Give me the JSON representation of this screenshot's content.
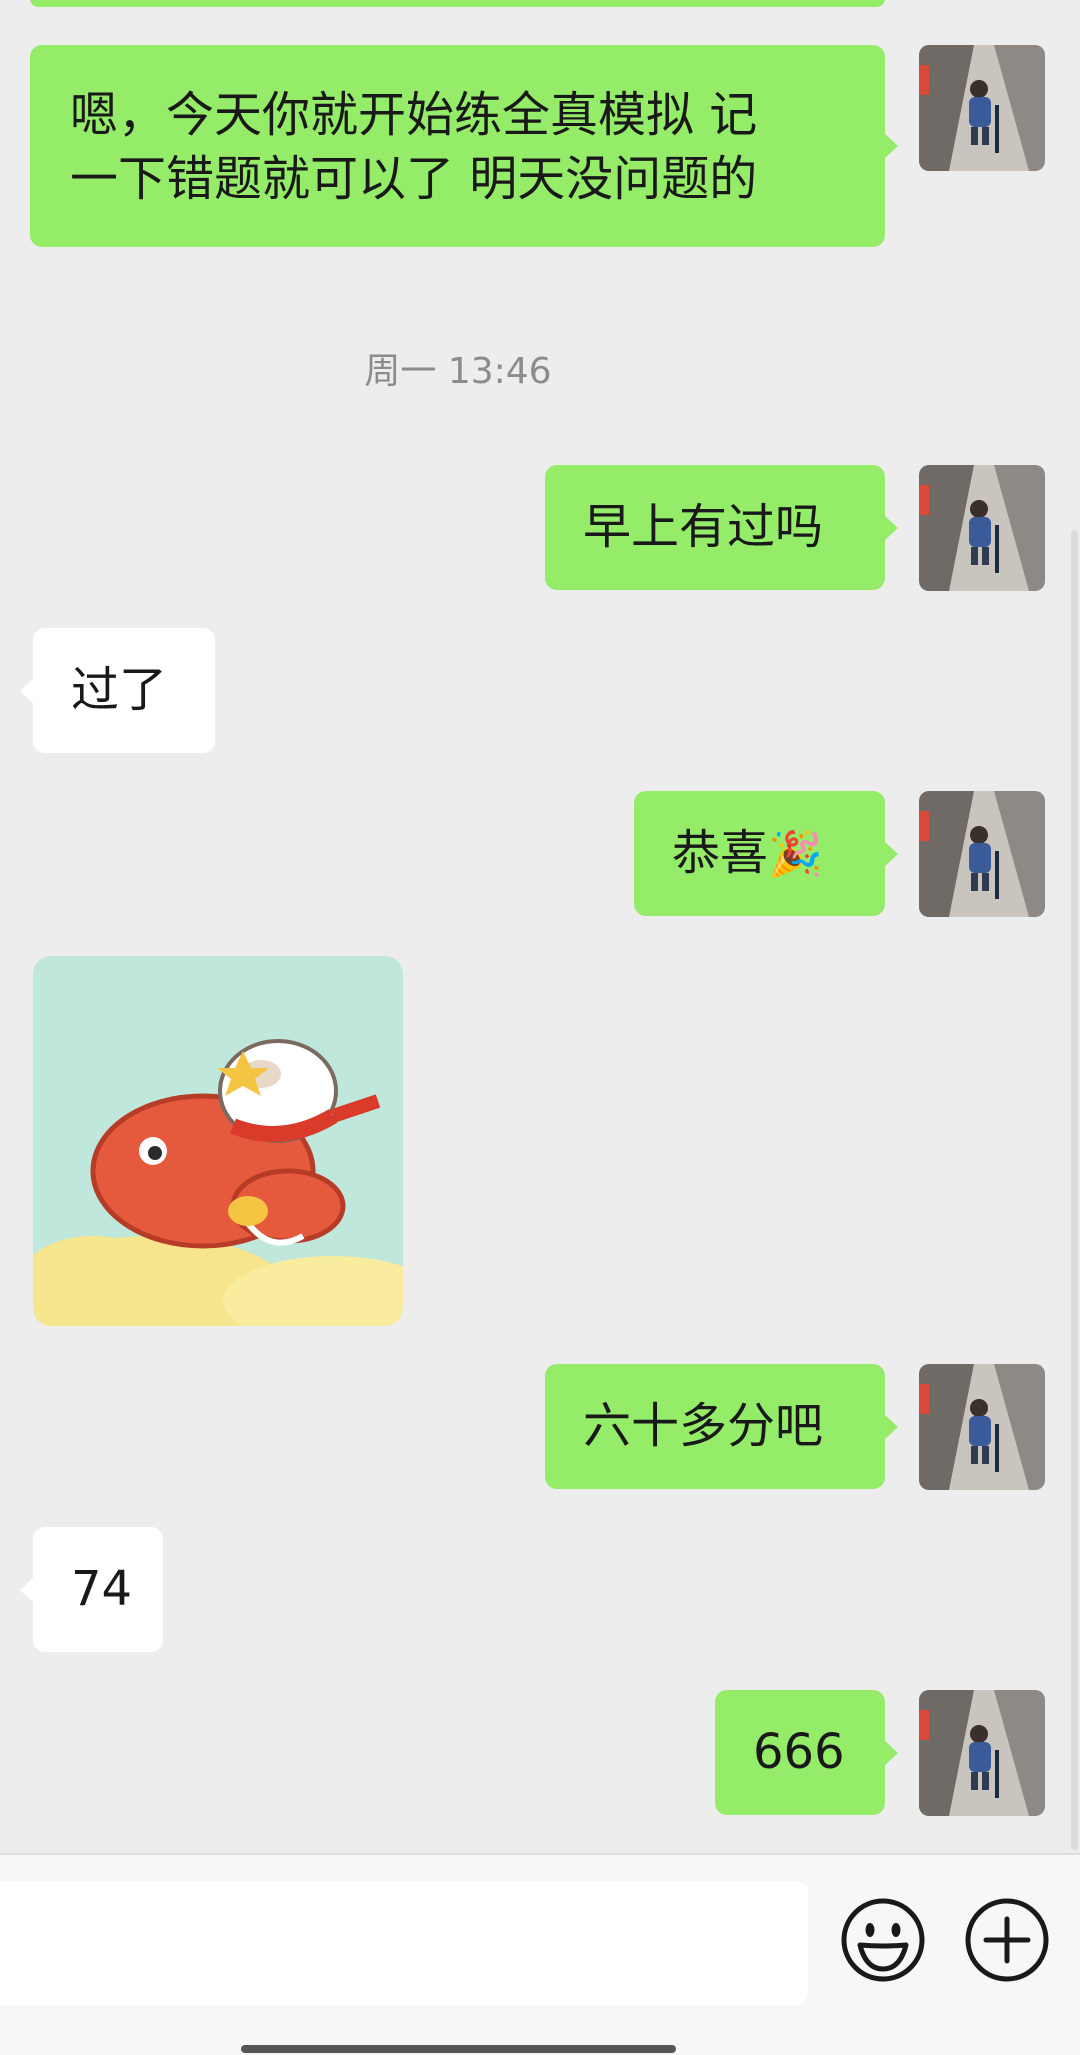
{
  "messages": [
    {
      "side": "me",
      "type": "text",
      "text": "嗯，今天你就开始练全真模拟 记一下错题就可以了 明天没问题的"
    },
    {
      "side": "center",
      "type": "timestamp",
      "text": "周一 13:46"
    },
    {
      "side": "me",
      "type": "text",
      "text": "早上有过吗"
    },
    {
      "side": "other",
      "type": "text",
      "text": "过了"
    },
    {
      "side": "me",
      "type": "text",
      "text": "恭喜🎉"
    },
    {
      "side": "other",
      "type": "sticker",
      "text": ""
    },
    {
      "side": "me",
      "type": "text",
      "text": "六十多分吧"
    },
    {
      "side": "other",
      "type": "text",
      "text": "74"
    },
    {
      "side": "me",
      "type": "text",
      "text": "666"
    }
  ],
  "chat": {
    "msg1_line1": "嗯，今天你就开始练全真模拟 记",
    "msg1_line2": "一下错题就可以了 明天没问题的",
    "timestamp": "周一 13:46",
    "msg2": "早上有过吗",
    "msg3": "过了",
    "msg4": "恭喜",
    "msg4_emoji": "🎉",
    "msg6": "六十多分吧",
    "msg7": "74",
    "msg8": "666"
  },
  "input_bar": {
    "value": "",
    "emoji_icon": "smiley-face-icon",
    "more_icon": "plus-circle-icon"
  },
  "colors": {
    "my_bubble": "#95ec69",
    "their_bubble": "#ffffff",
    "background": "#ededed",
    "timestamp_text": "#8c8c8c"
  }
}
